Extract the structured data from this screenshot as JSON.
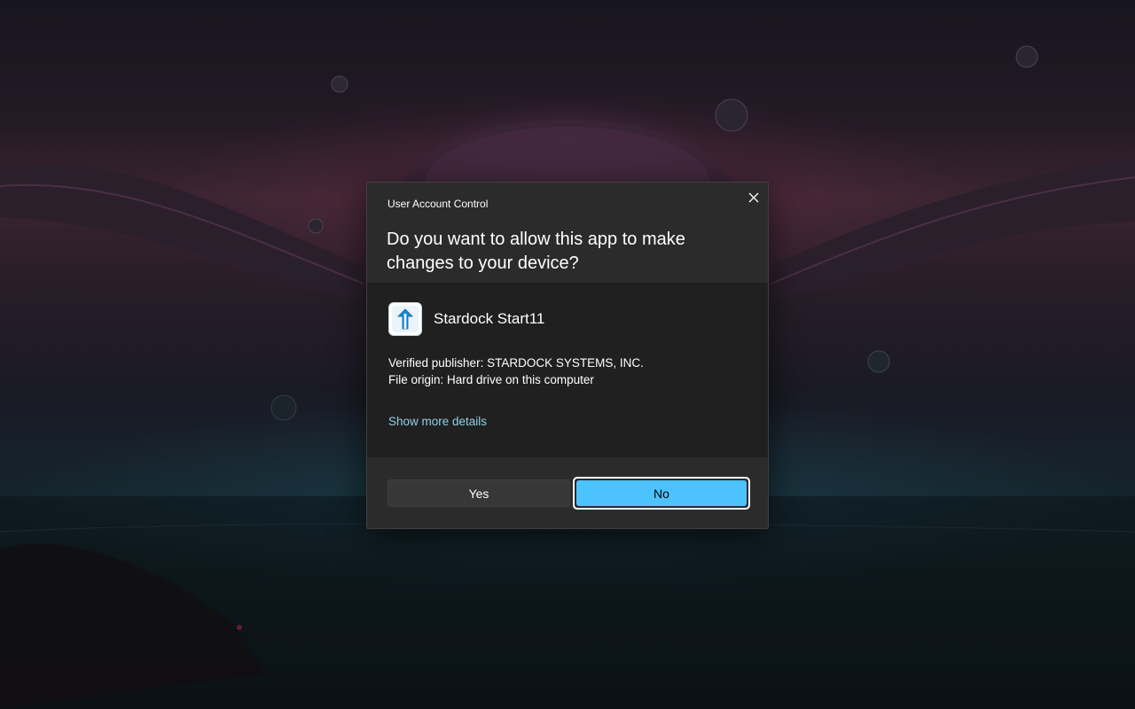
{
  "dialog": {
    "title": "User Account Control",
    "question": "Do you want to allow this app to make changes to your device?",
    "close_icon": "close-icon",
    "app": {
      "icon": "stardock-start11-icon",
      "name": "Stardock Start11"
    },
    "publisher": "Verified publisher: STARDOCK SYSTEMS, INC.",
    "origin": "File origin: Hard drive on this computer",
    "details_link": "Show more details",
    "buttons": {
      "yes": "Yes",
      "no": "No"
    }
  },
  "colors": {
    "dialog_header_bg": "#2b2b2b",
    "dialog_body_bg": "#202020",
    "accent": "#4cc2ff",
    "link": "#8fd0e8",
    "text": "#ffffff"
  }
}
